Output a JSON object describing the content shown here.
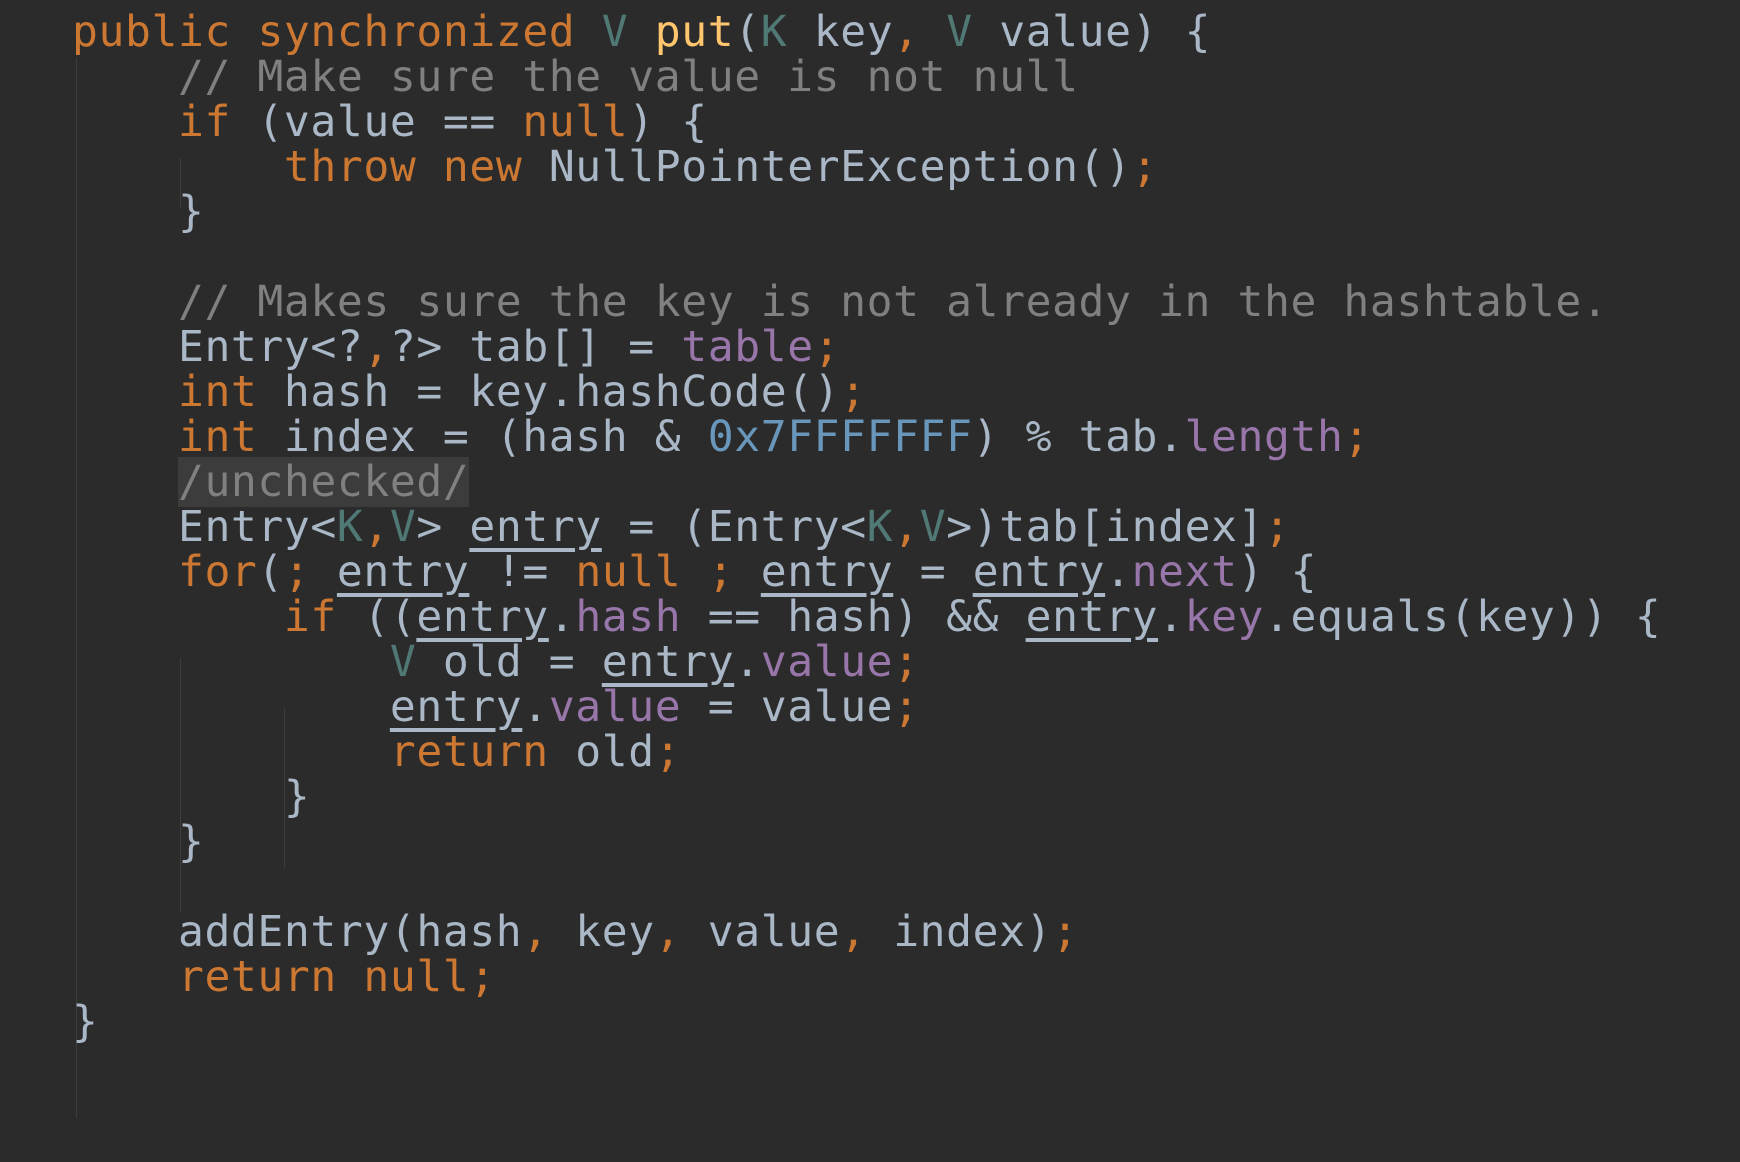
{
  "code": {
    "lines": [
      [
        {
          "t": "public",
          "c": "kw"
        },
        {
          "t": " "
        },
        {
          "t": "synchronized",
          "c": "kw"
        },
        {
          "t": " "
        },
        {
          "t": "V",
          "c": "tp"
        },
        {
          "t": " "
        },
        {
          "t": "put",
          "c": "fn"
        },
        {
          "t": "("
        },
        {
          "t": "K",
          "c": "tp"
        },
        {
          "t": " key"
        },
        {
          "t": ",",
          "c": "kw"
        },
        {
          "t": " "
        },
        {
          "t": "V",
          "c": "tp"
        },
        {
          "t": " value) {"
        }
      ],
      [
        {
          "t": "    "
        },
        {
          "t": "// Make sure the value is not null",
          "c": "cm"
        }
      ],
      [
        {
          "t": "    "
        },
        {
          "t": "if",
          "c": "kw"
        },
        {
          "t": " (value == "
        },
        {
          "t": "null",
          "c": "kw"
        },
        {
          "t": ") {"
        }
      ],
      [
        {
          "t": "        "
        },
        {
          "t": "throw",
          "c": "kw"
        },
        {
          "t": " "
        },
        {
          "t": "new",
          "c": "kw"
        },
        {
          "t": " NullPointerException()"
        },
        {
          "t": ";",
          "c": "kw"
        }
      ],
      [
        {
          "t": "    }"
        }
      ],
      [],
      [
        {
          "t": "    "
        },
        {
          "t": "// Makes sure the key is not already in the hashtable.",
          "c": "cm"
        }
      ],
      [
        {
          "t": "    Entry<?"
        },
        {
          "t": ",",
          "c": "kw"
        },
        {
          "t": "?> tab[] = "
        },
        {
          "t": "table",
          "c": "fd"
        },
        {
          "t": ";",
          "c": "kw"
        }
      ],
      [
        {
          "t": "    "
        },
        {
          "t": "int",
          "c": "kw"
        },
        {
          "t": " hash = key.hashCode()"
        },
        {
          "t": ";",
          "c": "kw"
        }
      ],
      [
        {
          "t": "    "
        },
        {
          "t": "int",
          "c": "kw"
        },
        {
          "t": " index = (hash & "
        },
        {
          "t": "0x7FFFFFFF",
          "c": "nm"
        },
        {
          "t": ") % tab."
        },
        {
          "t": "length",
          "c": "fd"
        },
        {
          "t": ";",
          "c": "kw"
        }
      ],
      [
        {
          "t": "    "
        },
        {
          "t": "/unchecked/",
          "c": "cm ann"
        }
      ],
      [
        {
          "t": "    Entry<"
        },
        {
          "t": "K",
          "c": "tp"
        },
        {
          "t": ",",
          "c": "kw"
        },
        {
          "t": "V",
          "c": "tp"
        },
        {
          "t": "> "
        },
        {
          "t": "entry",
          "c": "ul"
        },
        {
          "t": " = (Entry<"
        },
        {
          "t": "K",
          "c": "tp"
        },
        {
          "t": ",",
          "c": "kw"
        },
        {
          "t": "V",
          "c": "tp"
        },
        {
          "t": ">)tab[index]"
        },
        {
          "t": ";",
          "c": "kw"
        }
      ],
      [
        {
          "t": "    "
        },
        {
          "t": "for",
          "c": "kw"
        },
        {
          "t": "("
        },
        {
          "t": ";",
          "c": "kw"
        },
        {
          "t": " "
        },
        {
          "t": "entry",
          "c": "ul"
        },
        {
          "t": " != "
        },
        {
          "t": "null",
          "c": "kw"
        },
        {
          "t": " "
        },
        {
          "t": ";",
          "c": "kw"
        },
        {
          "t": " "
        },
        {
          "t": "entry",
          "c": "ul"
        },
        {
          "t": " = "
        },
        {
          "t": "entry",
          "c": "ul"
        },
        {
          "t": "."
        },
        {
          "t": "next",
          "c": "fd"
        },
        {
          "t": ") {"
        }
      ],
      [
        {
          "t": "        "
        },
        {
          "t": "if",
          "c": "kw"
        },
        {
          "t": " (("
        },
        {
          "t": "entry",
          "c": "ul"
        },
        {
          "t": "."
        },
        {
          "t": "hash",
          "c": "fd"
        },
        {
          "t": " == hash) && "
        },
        {
          "t": "entry",
          "c": "ul"
        },
        {
          "t": "."
        },
        {
          "t": "key",
          "c": "fd"
        },
        {
          "t": ".equals(key)) {"
        }
      ],
      [
        {
          "t": "            "
        },
        {
          "t": "V",
          "c": "tp"
        },
        {
          "t": " old = "
        },
        {
          "t": "entry",
          "c": "ul"
        },
        {
          "t": "."
        },
        {
          "t": "value",
          "c": "fd"
        },
        {
          "t": ";",
          "c": "kw"
        }
      ],
      [
        {
          "t": "            "
        },
        {
          "t": "entry",
          "c": "ul"
        },
        {
          "t": "."
        },
        {
          "t": "value",
          "c": "fd"
        },
        {
          "t": " = value"
        },
        {
          "t": ";",
          "c": "kw"
        }
      ],
      [
        {
          "t": "            "
        },
        {
          "t": "return",
          "c": "kw"
        },
        {
          "t": " old"
        },
        {
          "t": ";",
          "c": "kw"
        }
      ],
      [
        {
          "t": "        }"
        }
      ],
      [
        {
          "t": "    }"
        }
      ],
      [],
      [
        {
          "t": "    addEntry(hash"
        },
        {
          "t": ",",
          "c": "kw"
        },
        {
          "t": " key"
        },
        {
          "t": ",",
          "c": "kw"
        },
        {
          "t": " value"
        },
        {
          "t": ",",
          "c": "kw"
        },
        {
          "t": " index)"
        },
        {
          "t": ";",
          "c": "kw"
        }
      ],
      [
        {
          "t": "    "
        },
        {
          "t": "return",
          "c": "kw"
        },
        {
          "t": " "
        },
        {
          "t": "null",
          "c": "kw"
        },
        {
          "t": ";",
          "c": "kw"
        }
      ],
      [
        {
          "t": "}"
        }
      ]
    ]
  },
  "colors": {
    "background": "#2b2b2b",
    "text": "#a9b7c6",
    "keyword": "#cc7832",
    "method": "#ffc66d",
    "type_param": "#507874",
    "comment": "#808080",
    "field": "#9876aa",
    "number": "#6897bb"
  }
}
